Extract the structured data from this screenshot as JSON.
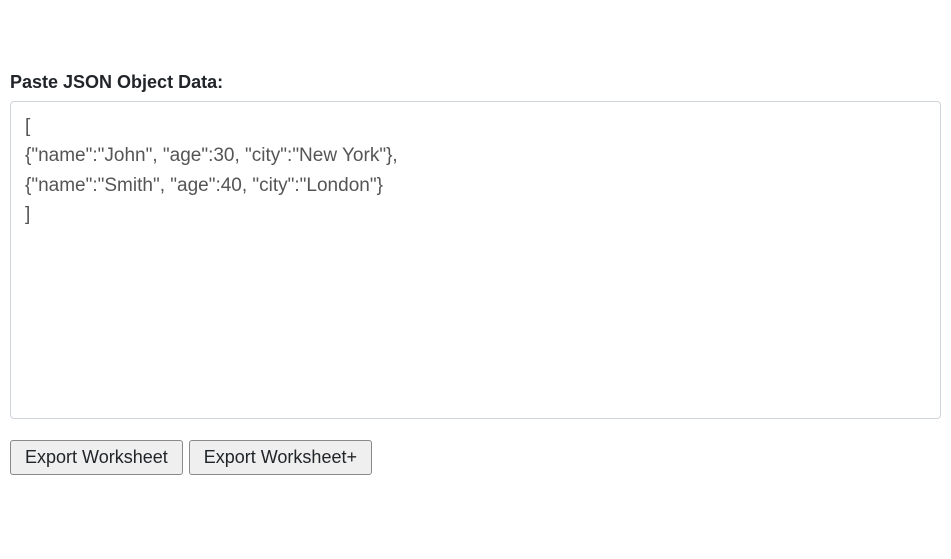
{
  "form": {
    "label": "Paste JSON Object Data:",
    "textarea_value": "[\n{\"name\":\"John\", \"age\":30, \"city\":\"New York\"},\n{\"name\":\"Smith\", \"age\":40, \"city\":\"London\"}\n]"
  },
  "buttons": {
    "export_worksheet": "Export Worksheet",
    "export_worksheet_plus": "Export Worksheet+"
  }
}
